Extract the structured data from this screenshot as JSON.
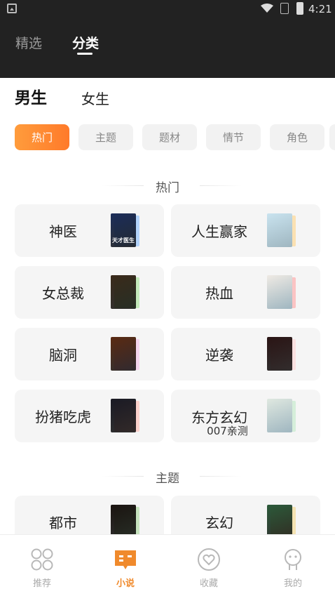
{
  "status_bar": {
    "time": "4:21"
  },
  "top_nav": {
    "tabs": [
      {
        "label": "精选"
      },
      {
        "label": "分类"
      }
    ],
    "active_index": 1
  },
  "gender_tabs": [
    {
      "label": "男生"
    },
    {
      "label": "女生"
    }
  ],
  "filter_chips": [
    {
      "label": "热门"
    },
    {
      "label": "主题"
    },
    {
      "label": "题材"
    },
    {
      "label": "情节"
    },
    {
      "label": "角色"
    }
  ],
  "sections": [
    {
      "title": "热门",
      "cards": [
        {
          "label": "神医",
          "cover_text": "天才医生",
          "cover_color": "#1b2d5a",
          "accent_color": "#7ab6ff"
        },
        {
          "label": "人生赢家",
          "cover_text": "",
          "cover_color": "#c9e3ef",
          "accent_color": "#ffd07a"
        },
        {
          "label": "女总裁",
          "cover_text": "",
          "cover_color": "#3a2a1a",
          "accent_color": "#9be08a"
        },
        {
          "label": "热血",
          "cover_text": "",
          "cover_color": "#efeae4",
          "accent_color": "#ff9a9a"
        },
        {
          "label": "脑洞",
          "cover_text": "",
          "cover_color": "#5a2a12",
          "accent_color": "#f3b8e8"
        },
        {
          "label": "逆袭",
          "cover_text": "",
          "cover_color": "#2a1414",
          "accent_color": "#ffcfcf"
        },
        {
          "label": "扮猪吃虎",
          "cover_text": "",
          "cover_color": "#1a1a24",
          "accent_color": "#ffb3a8"
        },
        {
          "label": "东方玄幻",
          "sub_label": "007亲测",
          "cover_text": "",
          "cover_color": "#dfe8e0",
          "accent_color": "#b9e8c2"
        }
      ]
    },
    {
      "title": "主题",
      "cards": [
        {
          "label": "都市",
          "cover_text": "",
          "cover_color": "#1a1410",
          "accent_color": "#9ed38f"
        },
        {
          "label": "玄幻",
          "cover_text": "",
          "cover_color": "#2c5a3a",
          "accent_color": "#f3d37a"
        }
      ]
    }
  ],
  "bottom_tabs": [
    {
      "label": "推荐"
    },
    {
      "label": "小说"
    },
    {
      "label": "收藏"
    },
    {
      "label": "我的"
    }
  ],
  "colors": {
    "accent": "#f08a2c",
    "topbar": "#222222",
    "card_bg": "#f5f5f5",
    "chip_bg": "#f2f2f2"
  }
}
